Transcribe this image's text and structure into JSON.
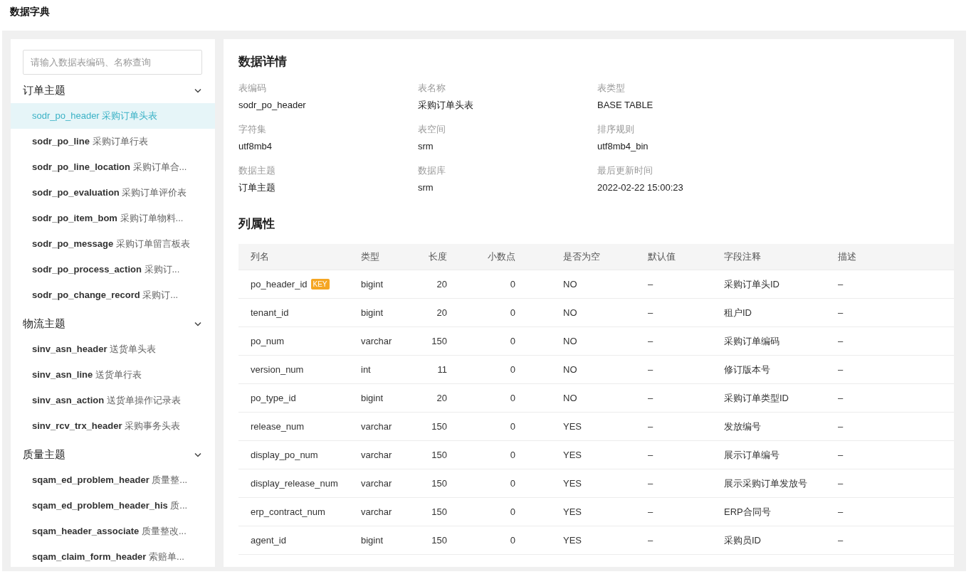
{
  "page_title": "数据字典",
  "sidebar": {
    "search": {
      "placeholder": "请输入数据表编码、名称查询"
    },
    "groups": [
      {
        "title": "订单主题",
        "expanded": true,
        "items": [
          {
            "code": "sodr_po_header",
            "name": "采购订单头表",
            "selected": true
          },
          {
            "code": "sodr_po_line",
            "name": "采购订单行表",
            "selected": false
          },
          {
            "code": "sodr_po_line_location",
            "name": "采购订单合...",
            "selected": false
          },
          {
            "code": "sodr_po_evaluation",
            "name": "采购订单评价表",
            "selected": false
          },
          {
            "code": "sodr_po_item_bom",
            "name": "采购订单物料...",
            "selected": false
          },
          {
            "code": "sodr_po_message",
            "name": "采购订单留言板表",
            "selected": false
          },
          {
            "code": "sodr_po_process_action",
            "name": "采购订...",
            "selected": false
          },
          {
            "code": "sodr_po_change_record",
            "name": "采购订...",
            "selected": false
          }
        ]
      },
      {
        "title": "物流主题",
        "expanded": true,
        "items": [
          {
            "code": "sinv_asn_header",
            "name": "送货单头表",
            "selected": false
          },
          {
            "code": "sinv_asn_line",
            "name": "送货单行表",
            "selected": false
          },
          {
            "code": "sinv_asn_action",
            "name": "送货单操作记录表",
            "selected": false
          },
          {
            "code": "sinv_rcv_trx_header",
            "name": "采购事务头表",
            "selected": false
          }
        ]
      },
      {
        "title": "质量主题",
        "expanded": true,
        "items": [
          {
            "code": "sqam_ed_problem_header",
            "name": "质量整...",
            "selected": false
          },
          {
            "code": "sqam_ed_problem_header_his",
            "name": "质...",
            "selected": false
          },
          {
            "code": "sqam_header_associate",
            "name": "质量整改...",
            "selected": false
          },
          {
            "code": "sqam_claim_form_header",
            "name": "索赔单...",
            "selected": false
          }
        ]
      }
    ]
  },
  "details": {
    "title": "数据详情",
    "fields": [
      {
        "label": "表编码",
        "value": "sodr_po_header"
      },
      {
        "label": "表名称",
        "value": "采购订单头表"
      },
      {
        "label": "表类型",
        "value": "BASE TABLE"
      },
      {
        "label": "字符集",
        "value": "utf8mb4"
      },
      {
        "label": "表空间",
        "value": "srm"
      },
      {
        "label": "排序规则",
        "value": "utf8mb4_bin"
      },
      {
        "label": "数据主题",
        "value": "订单主题"
      },
      {
        "label": "数据库",
        "value": "srm"
      },
      {
        "label": "最后更新时间",
        "value": "2022-02-22 15:00:23"
      }
    ]
  },
  "column_attributes": {
    "title": "列属性",
    "table": {
      "columns": [
        "列名",
        "类型",
        "长度",
        "小数点",
        "是否为空",
        "默认值",
        "字段注释",
        "描述"
      ],
      "rows": [
        {
          "cells": [
            "po_header_id",
            "bigint",
            "20",
            "0",
            "NO",
            "–",
            "采购订单头ID",
            "–"
          ],
          "badge": "KEY"
        },
        {
          "cells": [
            "tenant_id",
            "bigint",
            "20",
            "0",
            "NO",
            "–",
            "租户ID",
            "–"
          ]
        },
        {
          "cells": [
            "po_num",
            "varchar",
            "150",
            "0",
            "NO",
            "–",
            "采购订单编码",
            "–"
          ]
        },
        {
          "cells": [
            "version_num",
            "int",
            "11",
            "0",
            "NO",
            "–",
            "修订版本号",
            "–"
          ]
        },
        {
          "cells": [
            "po_type_id",
            "bigint",
            "20",
            "0",
            "NO",
            "–",
            "采购订单类型ID",
            "–"
          ]
        },
        {
          "cells": [
            "release_num",
            "varchar",
            "150",
            "0",
            "YES",
            "–",
            "发放编号",
            "–"
          ]
        },
        {
          "cells": [
            "display_po_num",
            "varchar",
            "150",
            "0",
            "YES",
            "–",
            "展示订单编号",
            "–"
          ]
        },
        {
          "cells": [
            "display_release_num",
            "varchar",
            "150",
            "0",
            "YES",
            "–",
            "展示采购订单发放号",
            "–"
          ]
        },
        {
          "cells": [
            "erp_contract_num",
            "varchar",
            "150",
            "0",
            "YES",
            "–",
            "ERP合同号",
            "–"
          ]
        },
        {
          "cells": [
            "agent_id",
            "bigint",
            "150",
            "0",
            "YES",
            "–",
            "采购员ID",
            "–"
          ]
        }
      ]
    }
  }
}
